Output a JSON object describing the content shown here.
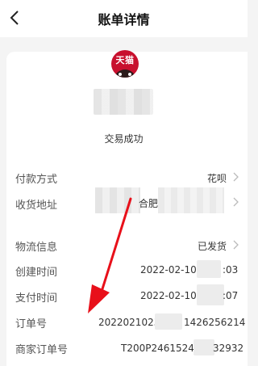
{
  "header": {
    "title": "账单详情"
  },
  "store": {
    "logo_text": "天猫"
  },
  "status": "交易成功",
  "rows": {
    "payment_method": {
      "label": "付款方式",
      "value": "花呗"
    },
    "shipping_address": {
      "label": "收货地址",
      "value_part": "合肥市-"
    },
    "logistics": {
      "label": "物流信息",
      "value": "已发货"
    },
    "created_time": {
      "label": "创建时间",
      "value_prefix": "2022-02-10",
      "value_suffix": ":03"
    },
    "paid_time": {
      "label": "支付时间",
      "value_prefix": "2022-02-10",
      "value_suffix": ":07"
    },
    "order_no": {
      "label": "订单号",
      "value_prefix": "2022021023",
      "value_suffix": "1426256214"
    },
    "merchant_order_no": {
      "label": "商家订单号",
      "value_prefix": "T200P2461524",
      "value_suffix": "32932"
    }
  },
  "colors": {
    "annotation_arrow": "#e8101a",
    "logo_bg": "#c8102e"
  },
  "icons": [
    "back-arrow-icon",
    "tmall-logo-icon",
    "chevron-right-icon"
  ]
}
